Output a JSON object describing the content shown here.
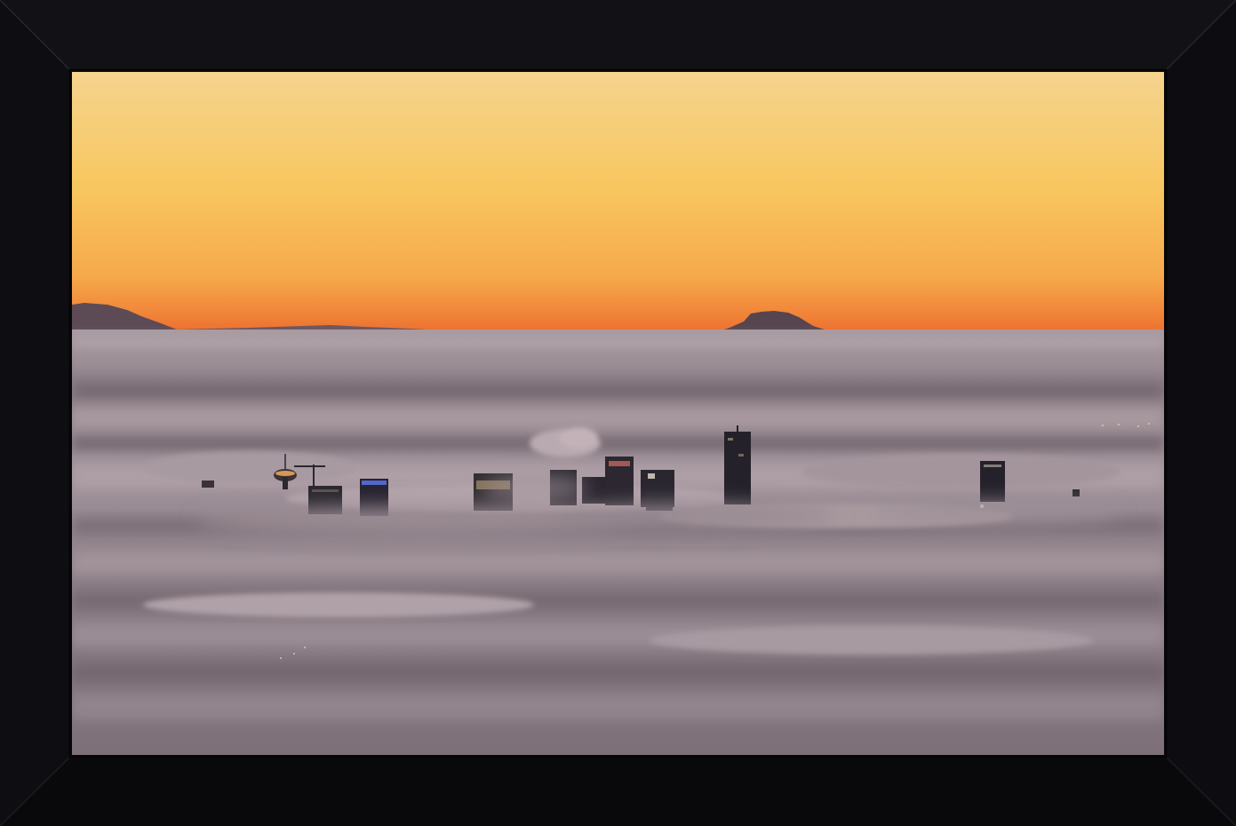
{
  "image": {
    "subject": "framed-photograph",
    "scene": "city-skyline-above-fog-at-sunset",
    "frame_color": "#0c0c10",
    "colors": {
      "sky_top": "#f5d48a",
      "sky_mid": "#f7c55c",
      "sky_horizon": "#f08a3a",
      "horizon_glow": "#ee6a2c",
      "mountains": "#5a4a55",
      "fog_light": "#b8a6ac",
      "fog_mid": "#8f7f86",
      "fog_dark": "#6c5f68",
      "buildings": "#2a2630"
    }
  }
}
